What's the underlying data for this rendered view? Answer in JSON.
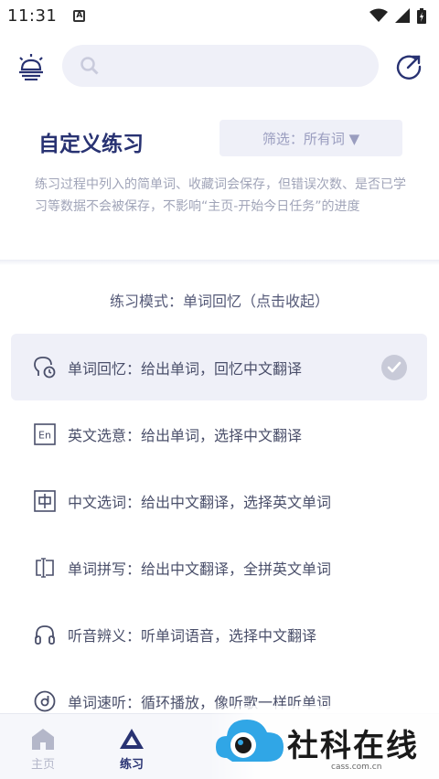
{
  "status_bar": {
    "time": "11:31",
    "notification_icon": "A"
  },
  "header": {
    "title": "自定义练习",
    "filter_label": "筛选：所有词 ▼",
    "search_placeholder": ""
  },
  "description": "练习过程中列入的简单词、收藏词会保存，但错误次数、是否已学习等数据不会被保存，不影响“主页-开始今日任务”的进度",
  "mode_section": {
    "title": "练习模式：单词回忆（点击收起）",
    "items": [
      {
        "label": "单词回忆：给出单词，回忆中文翻译",
        "icon": "brain-clock-icon",
        "selected": true
      },
      {
        "label": "英文选意：给出单词，选择中文翻译",
        "icon": "en-icon",
        "selected": false
      },
      {
        "label": "中文选词：给出中文翻译，选择英文单词",
        "icon": "zhong-icon",
        "selected": false
      },
      {
        "label": "单词拼写：给出中文翻译，全拼英文单词",
        "icon": "text-cursor-icon",
        "selected": false
      },
      {
        "label": "听音辨义：听单词语音，选择中文翻译",
        "icon": "headphones-icon",
        "selected": false
      },
      {
        "label": "单词速听：循环播放，像听歌一样听单词",
        "icon": "disc-icon",
        "selected": false
      }
    ]
  },
  "bottom_nav": {
    "home_label": "主页",
    "practice_label": "练习"
  },
  "watermark": {
    "text": "社科在线",
    "sub": "cass.com.cn"
  },
  "colors": {
    "accent": "#283272",
    "panel": "#eff0f8",
    "muted": "#a0a4b8"
  }
}
